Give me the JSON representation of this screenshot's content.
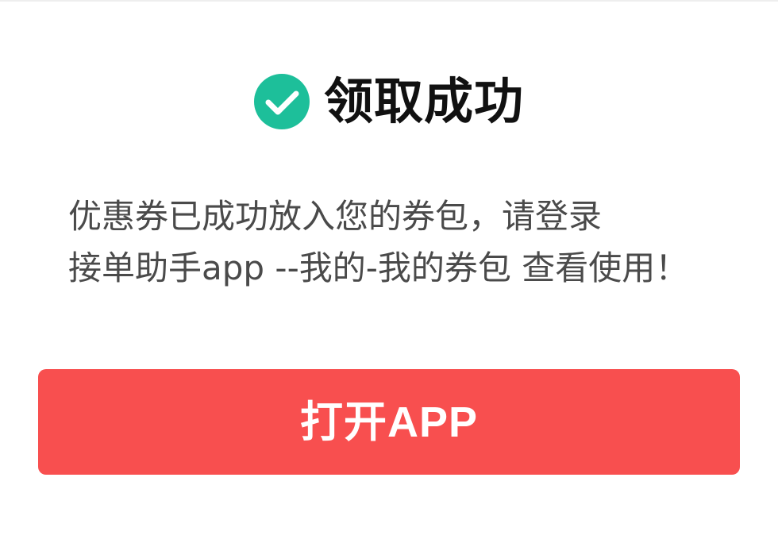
{
  "dialog": {
    "title": "领取成功",
    "message_lines": [
      "优惠券已成功放入您的券包，请登录",
      "接单助手app --我的-我的券包 查看使用！"
    ],
    "primary_button_label": "打开APP",
    "check_icon": "check-circle-icon"
  },
  "colors": {
    "success": "#1dbf9a",
    "button": "#f84f4f",
    "title_text": "#111111",
    "body_text": "#4a4a4a",
    "button_text": "#ffffff"
  }
}
